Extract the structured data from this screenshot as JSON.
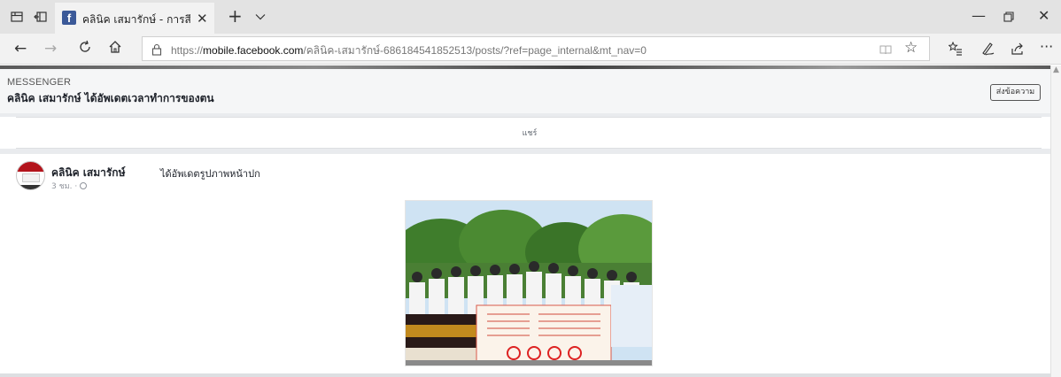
{
  "browser": {
    "tab_title": "คลินิค เสมารักษ์ - การสึกษ",
    "tab_favicon": "f",
    "url_scheme": "https://",
    "url_host": "mobile.facebook.com",
    "url_path": "/คลินิค-เสมารักษ์-686184541852513/posts/?ref=page_internal&mt_nav=0"
  },
  "messenger": {
    "label": "MESSENGER",
    "status": "คลินิค เสมารักษ์ ได้อัพเดตเวลาทำการของตน",
    "send_button": "ส่งข้อความ"
  },
  "share": {
    "label": "แชร์"
  },
  "post": {
    "author": "คลินิค เสมารักษ์",
    "action": "ได้อัพเดตรูปภาพหน้าปก",
    "time": "3 ชม. ·"
  },
  "colors": {
    "facebook_blue": "#3b5998",
    "page_bg": "#e9ebee",
    "chrome_bg": "#e3e3e3"
  }
}
